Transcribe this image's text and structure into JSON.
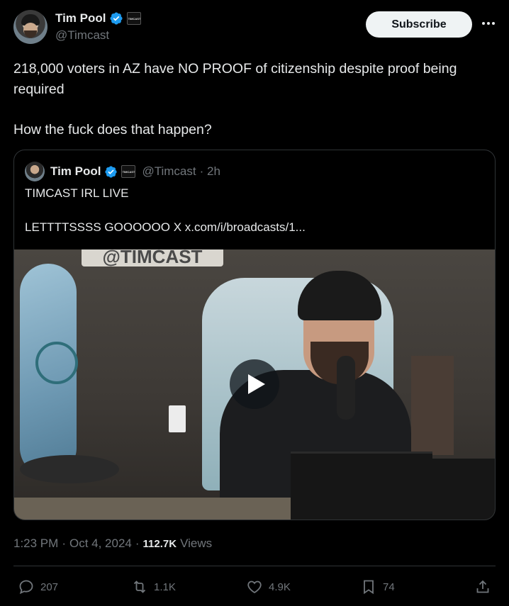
{
  "author": {
    "display_name": "Tim Pool",
    "handle": "@Timcast",
    "affiliate_badge_text": "TIMCAST",
    "verified_color": "#1d9bf0"
  },
  "header": {
    "subscribe_label": "Subscribe",
    "more_icon": "more-horizontal-icon"
  },
  "tweet": {
    "line1": "218,000 voters in AZ have NO PROOF of citizenship despite proof being required",
    "line2": "How the fuck does that happen?"
  },
  "quote": {
    "display_name": "Tim Pool",
    "handle": "@Timcast",
    "time": "· 2h",
    "line1": "TIMCAST IRL LIVE",
    "line2": "LETTTTSSSS GOOOOOO X x.com/i/broadcasts/1...",
    "media_sign_text": "@TIMCAST",
    "play_icon": "play-icon"
  },
  "meta": {
    "time": "1:23 PM",
    "date": "Oct 4, 2024",
    "sep1": "·",
    "sep2": "·",
    "views_count": "112.7K",
    "views_label": "Views"
  },
  "actions": {
    "replies": "207",
    "reposts": "1.1K",
    "likes": "4.9K",
    "bookmarks": "74"
  },
  "colors": {
    "background": "#000000",
    "text": "#e7e9ea",
    "muted": "#71767b",
    "border": "#2f3336"
  }
}
